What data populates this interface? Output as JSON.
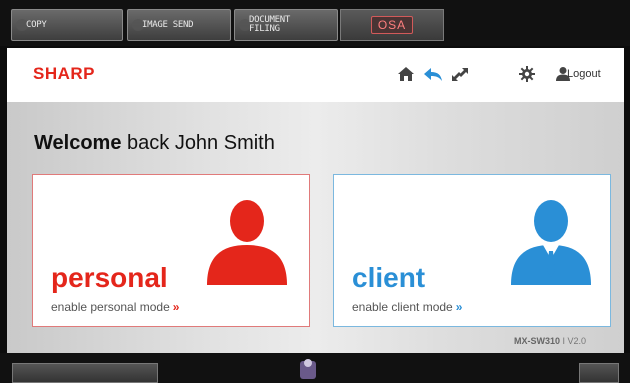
{
  "top_tabs": [
    {
      "label": "COPY",
      "icon": "copy-icon"
    },
    {
      "label": "IMAGE SEND",
      "icon": "image-send-icon"
    },
    {
      "label_line1": "DOCUMENT",
      "label_line2": "FILING",
      "icon": "document-filing-icon"
    }
  ],
  "osa_tab": {
    "label": "OSA"
  },
  "header": {
    "logo": "SHARP",
    "logout_label": "Logout",
    "icons": [
      "home-icon",
      "back-icon",
      "swap-icon",
      "gear-icon",
      "user-icon"
    ],
    "back_icon_color": "#2a8fd6"
  },
  "welcome": {
    "bold": "Welcome",
    "rest": " back John Smith"
  },
  "cards": {
    "personal": {
      "title": "personal",
      "subtitle": "enable personal mode",
      "arrow": "»",
      "color": "#e4261b"
    },
    "client": {
      "title": "client",
      "subtitle": "enable client mode",
      "arrow": "»",
      "color": "#2a8fd6"
    }
  },
  "model": {
    "name": "MX-SW310",
    "separator": " I ",
    "version": "V2.0"
  }
}
